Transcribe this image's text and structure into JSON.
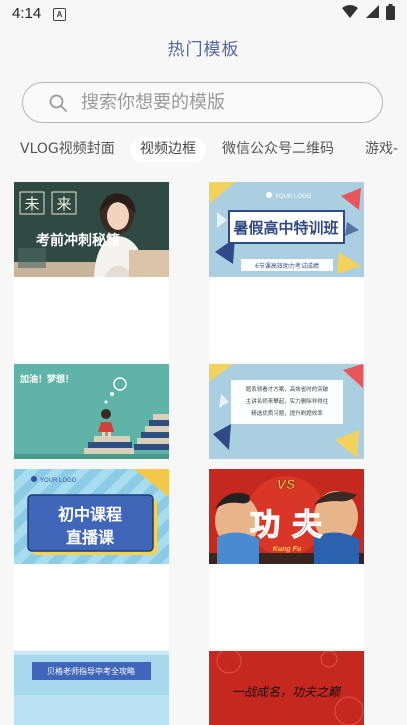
{
  "status_bar": {
    "time": "4:14",
    "notification_letter": "A",
    "icons": [
      "wifi-icon",
      "signal-icon",
      "battery-icon"
    ]
  },
  "header": {
    "title": "热门模板"
  },
  "search": {
    "placeholder": "搜索你想要的模版",
    "value": ""
  },
  "tabs": [
    {
      "label": "VLOG视频封面",
      "active": false
    },
    {
      "label": "视频边框",
      "active": true
    },
    {
      "label": "微信公众号二维码",
      "active": false
    },
    {
      "label": "游戏-",
      "active": false
    }
  ],
  "templates": [
    {
      "id": "t1",
      "lines": [
        "未",
        "来",
        "考前冲刺秘籍"
      ]
    },
    {
      "id": "t2",
      "lines": [
        "YOUR LOGO",
        "暑假高中特训班",
        "6节课高效助力考试成绩"
      ]
    },
    {
      "id": "t3",
      "lines": [
        "加油！梦想！"
      ]
    },
    {
      "id": "t4",
      "lines": [
        "题系领看才方案，高效省时的突破",
        "主讲名师来攀起，实力删除非得往",
        "精选优质习题，提升刷题效率"
      ]
    },
    {
      "id": "t5",
      "lines": [
        "YOUR LOGO",
        "初中课程",
        "直播课"
      ]
    },
    {
      "id": "t6",
      "lines": [
        "VS",
        "功",
        "夫",
        "Kung Fu"
      ]
    },
    {
      "id": "t7",
      "lines": [
        "贝格老师指导中考全攻略"
      ]
    },
    {
      "id": "t8",
      "lines": [
        "一战成名，功夫之巅"
      ]
    }
  ],
  "colors": {
    "title": "#5566a8",
    "background": "#f7f7f7",
    "chalkboard": "#2f4a43",
    "light_blue": "#a9cfe0",
    "kungfu_red": "#c5281f"
  }
}
